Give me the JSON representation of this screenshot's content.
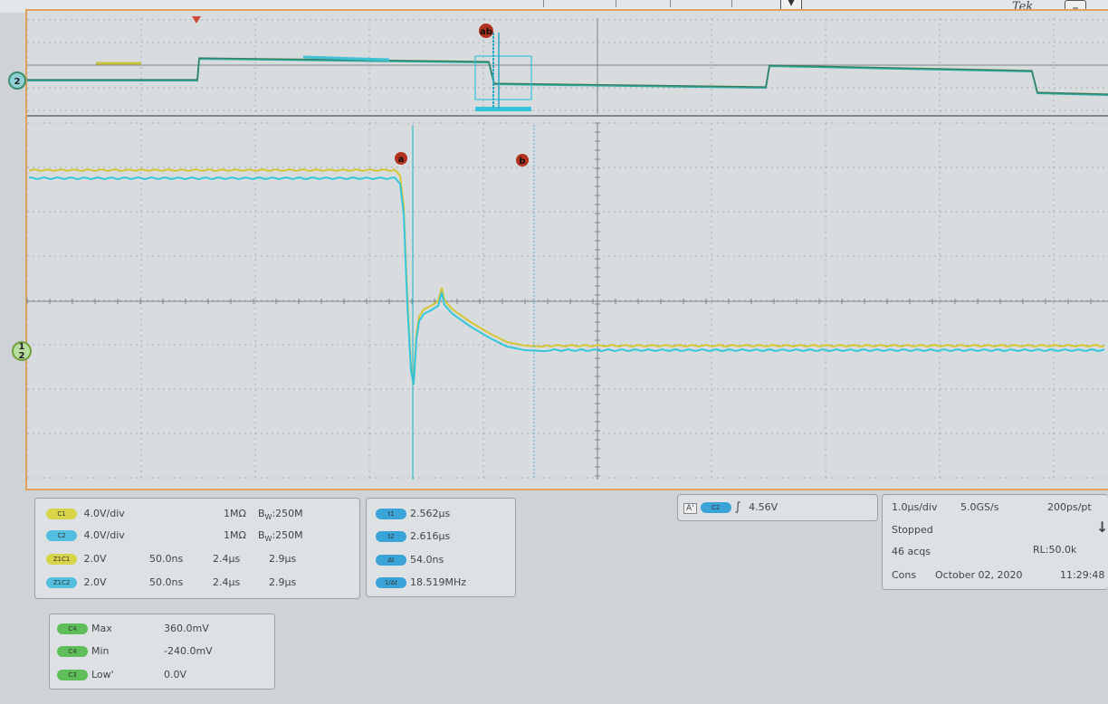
{
  "app": {
    "title_fragment": "Tek",
    "minimize_label": "–",
    "menu_button_label": "▾"
  },
  "markers": {
    "zoom_cursor": "ab",
    "cursor_a": "a",
    "cursor_b": "b",
    "overview_channel": "2",
    "main_channel_a": "1",
    "main_channel_b": "2"
  },
  "channels": [
    {
      "pill": "C1",
      "scale": "4.0V/div",
      "impedance": "1MΩ",
      "bw_prefix": "B",
      "bw_sub": "W",
      "bw_value": ":250M",
      "color": "#d8d44a"
    },
    {
      "pill": "C2",
      "scale": "4.0V/div",
      "impedance": "1MΩ",
      "bw_prefix": "B",
      "bw_sub": "W",
      "bw_value": ":250M",
      "color": "#52bfe0"
    }
  ],
  "zooms": [
    {
      "pill": "Z1C1",
      "v": "2.0V",
      "t": "50.0ns",
      "p": "2.4μs",
      "w": "2.9μs"
    },
    {
      "pill": "Z1C2",
      "v": "2.0V",
      "t": "50.0ns",
      "p": "2.4μs",
      "w": "2.9μs"
    }
  ],
  "cursors": [
    {
      "pill": "t1",
      "value": "2.562μs"
    },
    {
      "pill": "t2",
      "value": "2.616μs"
    },
    {
      "pill": "Δt",
      "value": "54.0ns"
    },
    {
      "pill": "1/Δt",
      "value": "18.519MHz"
    }
  ],
  "trigger": {
    "pill_a": "A'",
    "pill_ch": "C2",
    "level": "4.56V"
  },
  "acquisition": {
    "timebase": "1.0μs/div",
    "sample_rate": "5.0GS/s",
    "resolution": "200ps/pt",
    "state": "Stopped",
    "acqs": "46 acqs",
    "record_length": "RL:50.0k",
    "mode": "Cons",
    "date": "October 02, 2020",
    "time": "11:29:48"
  },
  "measurements": [
    {
      "pill": "C4",
      "label": "Max",
      "value": "360.0mV"
    },
    {
      "pill": "C4",
      "label": "Min",
      "value": "-240.0mV"
    },
    {
      "pill": "C3",
      "label": "Low'",
      "value": "0.0V"
    }
  ],
  "colors": {
    "ch1": "#d8c83a",
    "ch2": "#35c4dc",
    "frame": "#e1a25e",
    "cursor": "#3ab9c9"
  }
}
